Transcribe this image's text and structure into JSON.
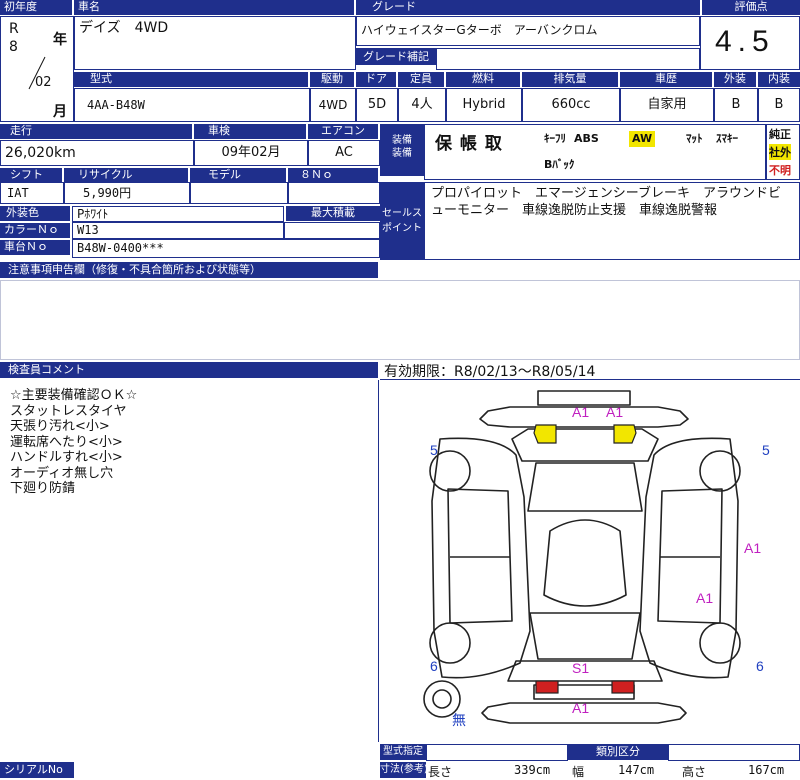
{
  "header": {
    "year_label": "初年度",
    "name_label": "車名",
    "grade_label": "グレード",
    "score_label": "評価点"
  },
  "year": {
    "era": "R",
    "year": "8",
    "year_unit": "年",
    "month": "02",
    "month_unit": "月"
  },
  "car_name": "デイズ　4WD",
  "grade": "ハイウェイスターGターボ　アーバンクロム",
  "grade_note_label": "グレード補記",
  "score": "4.5",
  "spec_labels": [
    "型式",
    "駆動",
    "ドア",
    "定員",
    "燃料",
    "排気量",
    "車歴",
    "外装",
    "内装"
  ],
  "spec_values": [
    "4AA-B48W",
    "4WD",
    "5D",
    "4人",
    "Hybrid",
    "660cc",
    "自家用",
    "B",
    "B"
  ],
  "row2_labels": [
    "走行",
    "車検",
    "エアコン"
  ],
  "mileage": "26,020km",
  "inspection": "09年02月",
  "aircon": "AC",
  "equipment_label": "装備",
  "equipment_label2": "装備",
  "warranty": "保 帳 取",
  "equip_badges": {
    "keyless": "ｷｰﾌﾘ",
    "abs": "ABS",
    "aw": "AW",
    "mat": "ﾏｯﾄ",
    "smartkey": "ｽﾏｷｰ",
    "airbag": "Bﾊﾞｯｸ"
  },
  "right_badges": {
    "genuine": "純正",
    "aftermarket": "社外",
    "unknown": "不明"
  },
  "row3_labels": [
    "シフト",
    "リサイクル",
    "モデル",
    "８Ｎｏ"
  ],
  "shift": "IAT",
  "recycle": "5,990円",
  "sales_label": "セールスポイント",
  "sales_point": "プロパイロット　エマージェンシーブレーキ　アラウンドビューモニター　車線逸脱防止支援　車線逸脱警報",
  "exterior_color_label": "外装色",
  "exterior_color": "Pﾎﾜｲﾄ",
  "max_load_label": "最大積載",
  "color_no_label": "カラーＮｏ",
  "color_no": "W13",
  "chassis_no_label": "車台Ｎｏ",
  "chassis_no": "B48W-0400***",
  "notes_label": "注意事項申告欄（修復・不具合箇所および状態等）",
  "inspector_label": "検査員コメント",
  "validity": "有効期限：R8/02/13～R8/05/14",
  "comments": [
    "☆主要装備確認ＯＫ☆",
    "スタットレスタイヤ",
    "天張り汚れ<小>",
    "運転席へたり<小>",
    "ハンドルすれ<小>",
    "オーディオ無し穴",
    "下廻り防錆"
  ],
  "damage": {
    "front1": "A1",
    "front2": "A1",
    "right_side": "A1",
    "roof": "A1",
    "rear_s1": "S1",
    "rear_a1": "A1",
    "tire_fl": "5",
    "tire_fr": "5",
    "tire_rl": "6",
    "tire_rr": "6",
    "spare": "無"
  },
  "footer": {
    "serial_label": "シリアルNo",
    "type_label": "型式指定",
    "size_label": "寸法(参考)",
    "class_label": "類別区分",
    "length_label": "長さ",
    "length": "339cm",
    "width_label": "幅",
    "width": "147cm",
    "height_label": "高さ",
    "height": "167cm"
  },
  "colors": {
    "header_blue": "#1f2f8c",
    "highlight_yellow": "#f2e600",
    "mark_magenta": "#c020c0",
    "tire_blue": "#2040c0",
    "tail_red": "#d02020"
  }
}
